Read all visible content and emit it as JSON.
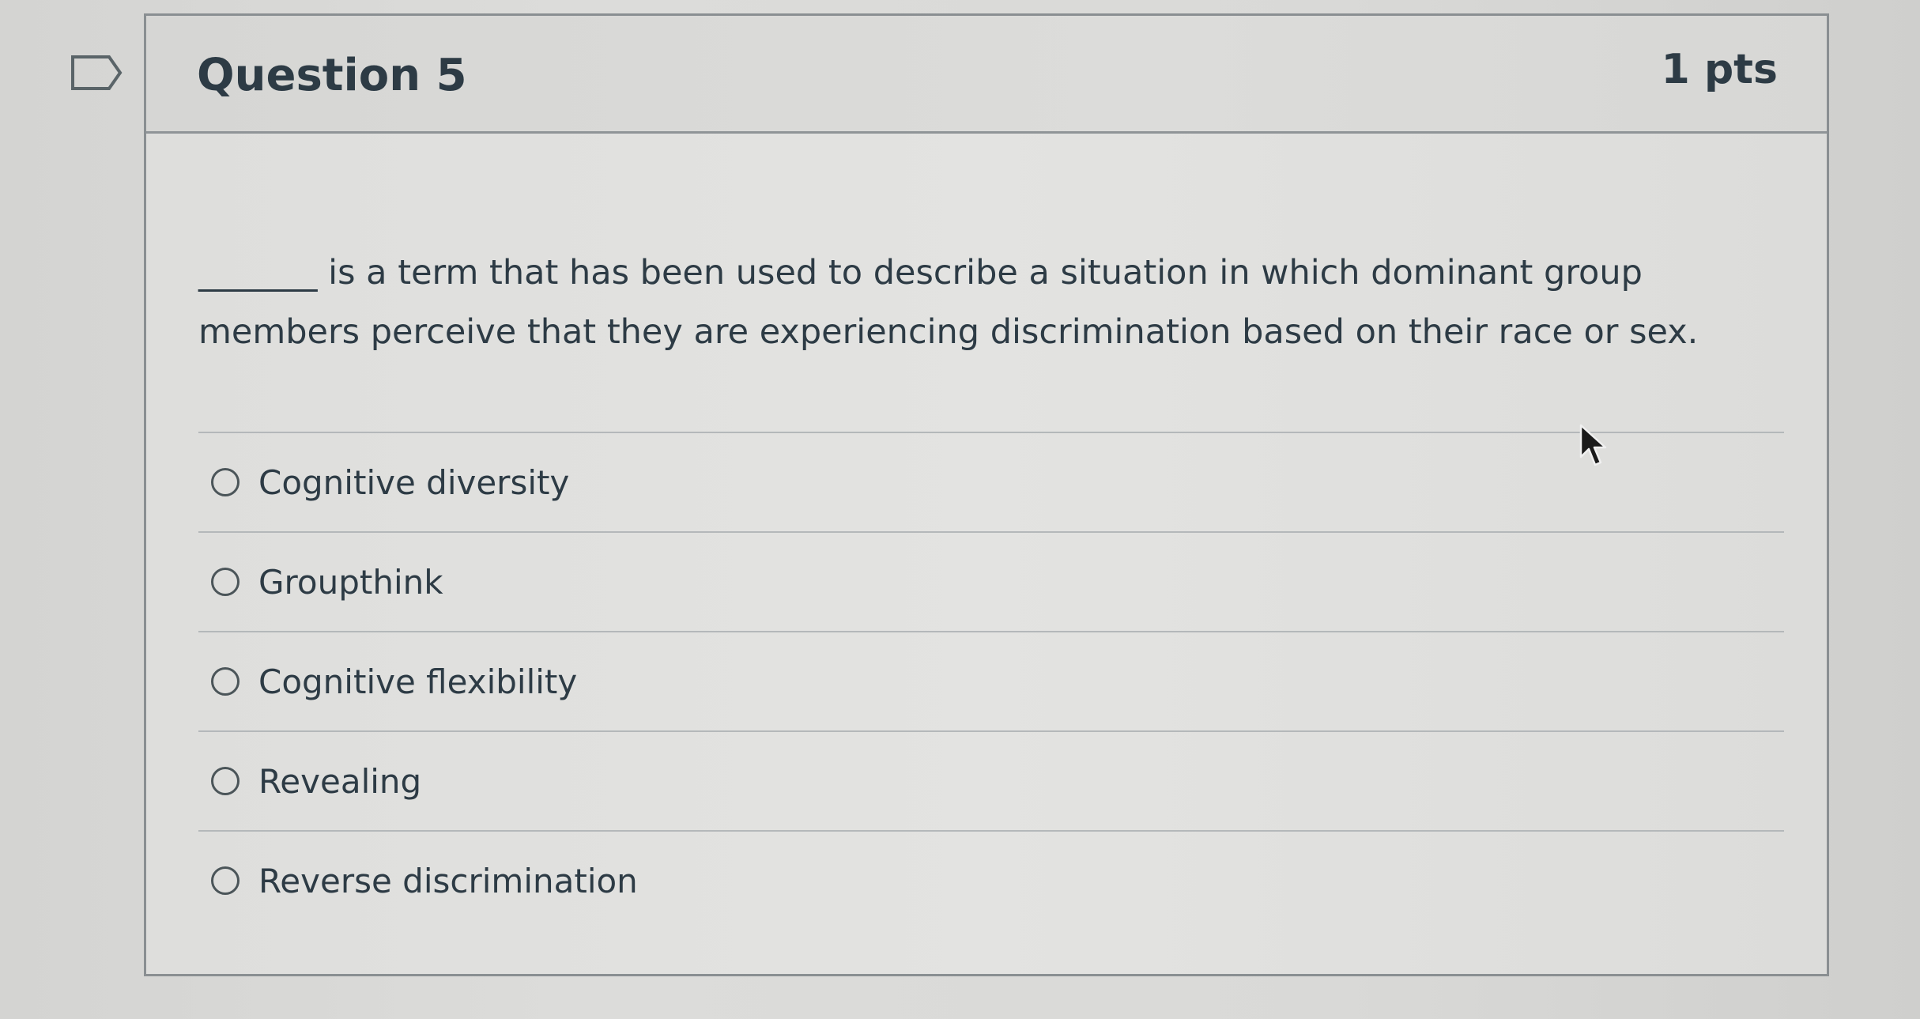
{
  "question": {
    "title": "Question 5",
    "points": "1 pts",
    "text": "_______ is a term that has been used to describe a situation in which dominant group members perceive that they are experiencing discrimination based on their race or sex."
  },
  "answers": [
    {
      "label": "Cognitive diversity",
      "selected": false
    },
    {
      "label": "Groupthink",
      "selected": false
    },
    {
      "label": "Cognitive flexibility",
      "selected": false
    },
    {
      "label": "Revealing",
      "selected": false
    },
    {
      "label": "Reverse discrimination",
      "selected": false
    }
  ],
  "icons": {
    "flag": "flag-question-icon",
    "radio": "radio-button-icon",
    "cursor": "mouse-pointer-icon"
  },
  "colors": {
    "text": "#2d3b45",
    "border": "#8a8f92",
    "divider": "#b4b8ba"
  }
}
